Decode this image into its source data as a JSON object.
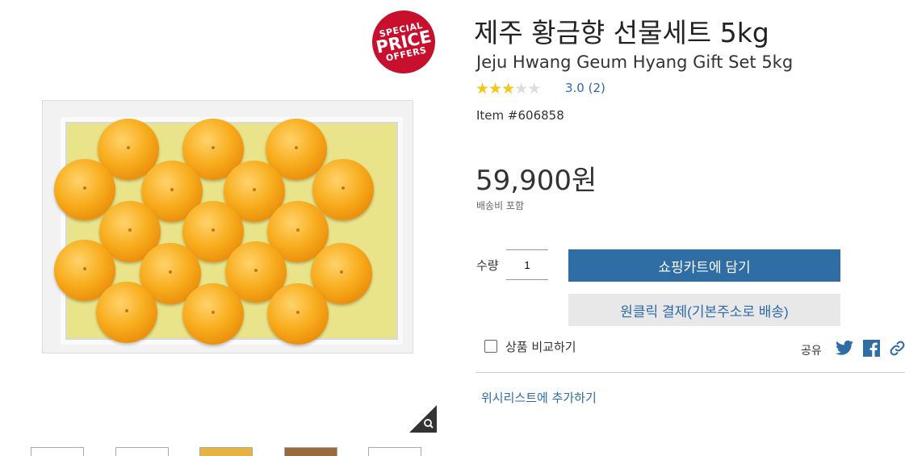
{
  "badge": {
    "line1": "SPECIAL",
    "line2": "PRICE",
    "line3": "OFFERS",
    "color": "#c8102e"
  },
  "product": {
    "title_ko": "제주 황금향 선물세트 5kg",
    "title_en": "Jeju Hwang Geum Hyang Gift Set 5kg",
    "rating_value": 3.0,
    "rating_text": "3.0",
    "review_count": "(2)",
    "item_number": "Item #606858",
    "price": "59,900원",
    "shipping_note": "배송비 포함"
  },
  "purchase": {
    "qty_label": "수량",
    "qty_value": "1",
    "add_to_cart": "쇼핑카트에 담기",
    "one_click": "원클릭 결제(기본주소로 배송)",
    "compare_label": "상품 비교하기",
    "share_label": "공유",
    "wishlist": "위시리스트에 추가하기"
  },
  "icons": {
    "zoom": "magnifier-icon",
    "twitter": "twitter-icon",
    "facebook": "facebook-icon",
    "link": "link-icon",
    "star": "star-icon"
  },
  "colors": {
    "primary": "#2f6da5",
    "link": "#2b6aa8",
    "star": "#f5c518"
  }
}
